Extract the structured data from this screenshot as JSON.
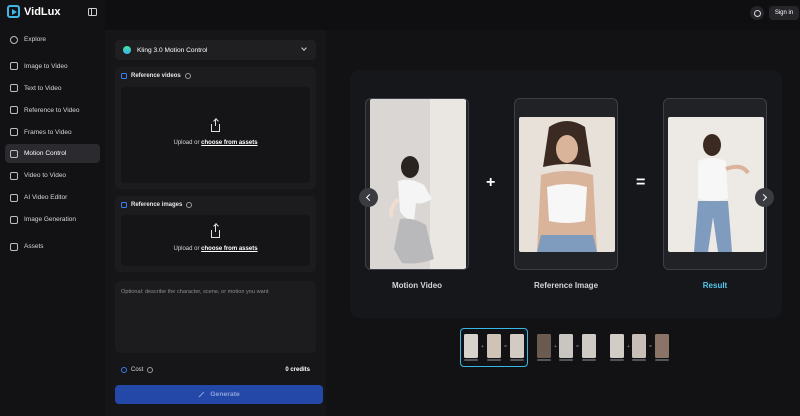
{
  "app": {
    "name": "VidLux"
  },
  "header": {
    "signin_label": "Sign in",
    "language_icon": "globe-icon"
  },
  "sidebar": {
    "items": [
      {
        "label": "Explore",
        "icon": "compass-icon"
      },
      {
        "label": "Image to Video",
        "icon": "image-icon"
      },
      {
        "label": "Text to Video",
        "icon": "magic-wand-icon"
      },
      {
        "label": "Reference to Video",
        "icon": "reference-icon"
      },
      {
        "label": "Frames to Video",
        "icon": "frames-icon"
      },
      {
        "label": "Motion Control",
        "icon": "motion-icon",
        "active": true
      },
      {
        "label": "Video to Video",
        "icon": "video-icon"
      },
      {
        "label": "AI Video Editor",
        "icon": "editor-icon"
      },
      {
        "label": "Image Generation",
        "icon": "image-generation-icon"
      },
      {
        "label": "Assets",
        "icon": "folder-icon"
      }
    ]
  },
  "form": {
    "model": "Kling 3.0 Motion Control",
    "reference_videos": {
      "title": "Reference videos",
      "upload": "Upload",
      "or": "or",
      "choose": "choose from assets"
    },
    "reference_images": {
      "title": "Reference images",
      "upload": "Upload",
      "or": "or",
      "choose": "choose from assets"
    },
    "prompt_placeholder": "Optional: describe the character, scene, or motion you want",
    "cost_label": "Cost",
    "cost_value": "0 credits",
    "generate_label": "Generate"
  },
  "preview": {
    "motion_label": "Motion Video",
    "reference_label": "Reference Image",
    "result_label": "Result",
    "plus": "+",
    "equals": "=",
    "accent_color": "#56c6ec"
  }
}
